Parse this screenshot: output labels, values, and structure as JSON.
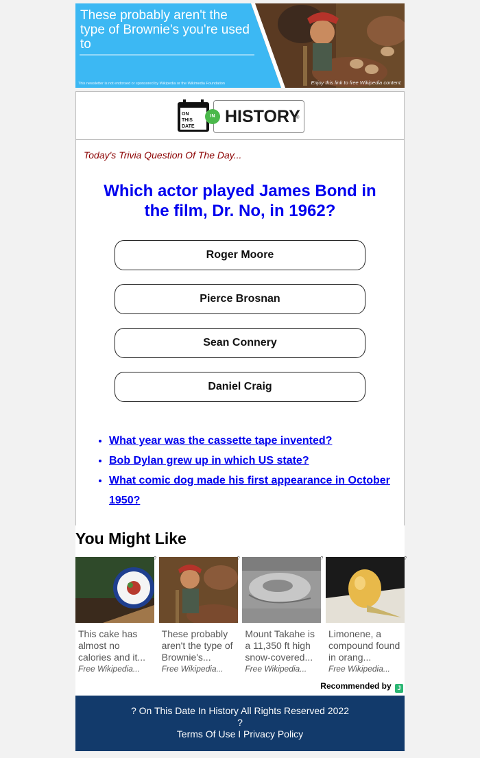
{
  "banner": {
    "headline": "These probably aren't the type of Brownie's you're used to",
    "disclaimer": "This newsletter is not endorsed or sponsored by Wikipedia or the Wikimedia Foundation",
    "credit": "Enjoy this link to free Wikipedia content.",
    "colors": {
      "background": "#3cb8f3"
    }
  },
  "logo": {
    "calendar_text": [
      "ON",
      "THIS",
      "DATE"
    ],
    "circle_text": "IN",
    "wordmark": "HISTORY",
    "registered": "®",
    "colors": {
      "circle": "#4bb84b"
    }
  },
  "trivia": {
    "kicker": "Today's Trivia Question Of The Day...",
    "question": "Which actor played James Bond in the film, Dr. No, in 1962?",
    "answers": [
      "Roger Moore",
      "Pierce Brosnan",
      "Sean Connery",
      "Daniel Craig"
    ]
  },
  "related_links": [
    "What year was the cassette tape invented?",
    "Bob Dylan grew up in which US state?",
    "What comic dog made his first appearance in October 1950?"
  ],
  "recommendations": {
    "title": "You Might Like",
    "items": [
      {
        "text": "This cake has almost no calories and it...",
        "source": "Free Wikipedia...",
        "marker": "?"
      },
      {
        "text": "These probably aren't the type of Brownie's...",
        "source": "Free Wikipedia...",
        "marker": "?"
      },
      {
        "text": "Mount Takahe is a 11,350 ft high snow-covered...",
        "source": "Free Wikipedia...",
        "marker": "?"
      },
      {
        "text": "Limonene, a compound found in orang...",
        "source": "Free Wikipedia...",
        "marker": "?"
      }
    ],
    "recommended_by": "Recommended by",
    "badge": "J"
  },
  "footer": {
    "copyright": "? On This Date In History All Rights Reserved 2022",
    "separator_mark": "?",
    "terms": "Terms Of Use",
    "divider": "I",
    "privacy": "Privacy Policy",
    "colors": {
      "background": "#123a6b"
    }
  }
}
